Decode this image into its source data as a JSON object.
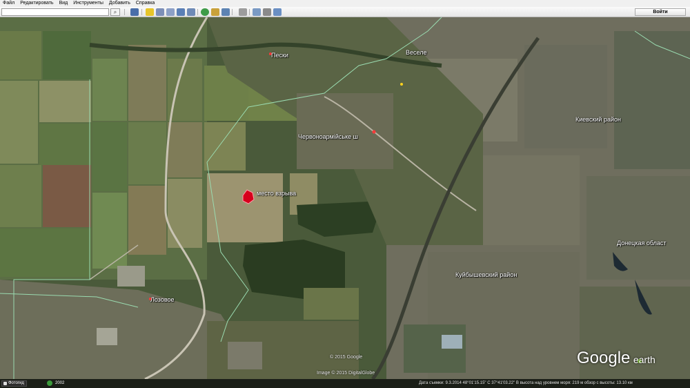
{
  "menu": [
    "Файл",
    "Редактировать",
    "Вид",
    "Инструменты",
    "Добавить",
    "Справка"
  ],
  "toolbar": {
    "search_value": "",
    "search_icon": "search-icon",
    "login_label": "Войти",
    "buttons": [
      "sidebar-icon",
      "placemark-icon",
      "polygon-icon",
      "path-icon",
      "image-overlay-icon",
      "record-tour-icon",
      "historical-imagery-icon",
      "sun-icon",
      "planets-icon",
      "ruler-icon",
      "email-icon",
      "print-icon",
      "google-maps-icon"
    ]
  },
  "map": {
    "labels": {
      "peski": "Пески",
      "vesele": "Веселе",
      "chervonoarmiyske": "Червоноармійське ш",
      "kievsky": "Киевский район",
      "explosion_site": "место взрыва",
      "kuibyshevsky": "Куйбышевский район",
      "donetsk_oblast": "Донецкая област",
      "lozovoe": "Лозовое"
    },
    "copyright_1": "© 2015 Google",
    "copyright_2": "Image © 2015 DigitalGlobe",
    "logo_google": "Google",
    "logo_earth": "earth"
  },
  "status": {
    "photo_label": "Фотогид",
    "year": "2002",
    "info": "Дата съемки: 9.3.2014   48°01'15.15\" С   37°41'03.22\" В  высота над уровнем моря: 219 м   обзор с высоты: 13.10 км"
  }
}
